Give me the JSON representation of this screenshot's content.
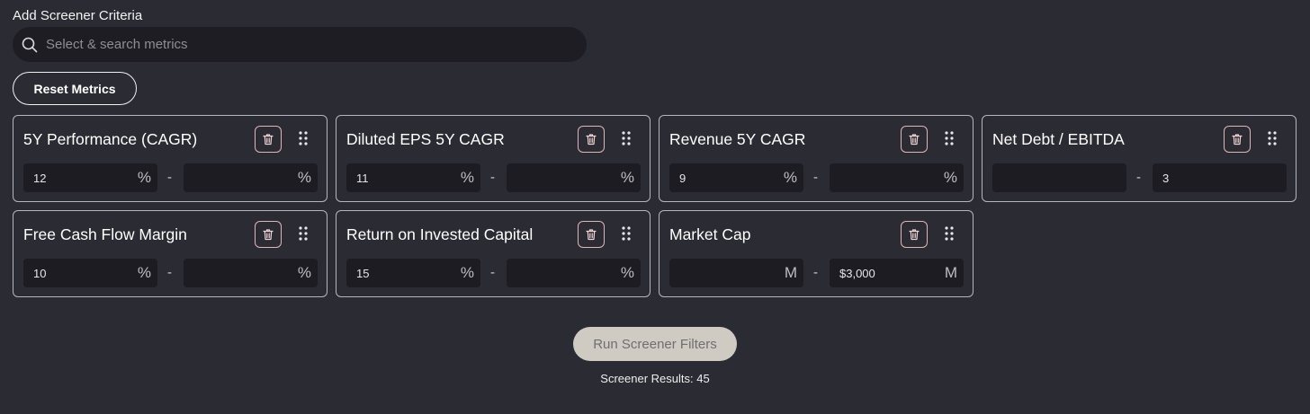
{
  "heading": "Add Screener Criteria",
  "search": {
    "placeholder": "Select & search metrics",
    "icon": "search-icon"
  },
  "reset_label": "Reset Metrics",
  "cards": [
    {
      "title": "5Y Performance (CAGR)",
      "min": "12",
      "max": "",
      "unit": "%"
    },
    {
      "title": "Diluted EPS 5Y CAGR",
      "min": "11",
      "max": "",
      "unit": "%"
    },
    {
      "title": "Revenue 5Y CAGR",
      "min": "9",
      "max": "",
      "unit": "%"
    },
    {
      "title": "Net Debt / EBITDA",
      "min": "",
      "max": "3",
      "unit": ""
    },
    {
      "title": "Free Cash Flow Margin",
      "min": "10",
      "max": "",
      "unit": "%"
    },
    {
      "title": "Return on Invested Capital",
      "min": "15",
      "max": "",
      "unit": "%"
    },
    {
      "title": "Market Cap",
      "min": "",
      "max": "$3,000",
      "unit": "M"
    }
  ],
  "range_separator": "-",
  "run_label": "Run Screener Filters",
  "results_text": "Screener Results: 45",
  "colors": {
    "background": "#2b2b33",
    "field_background": "#1c1c22",
    "card_border": "#b5b5bb",
    "trash_border": "#e0b5b5",
    "run_button": "#cfcbc3"
  }
}
